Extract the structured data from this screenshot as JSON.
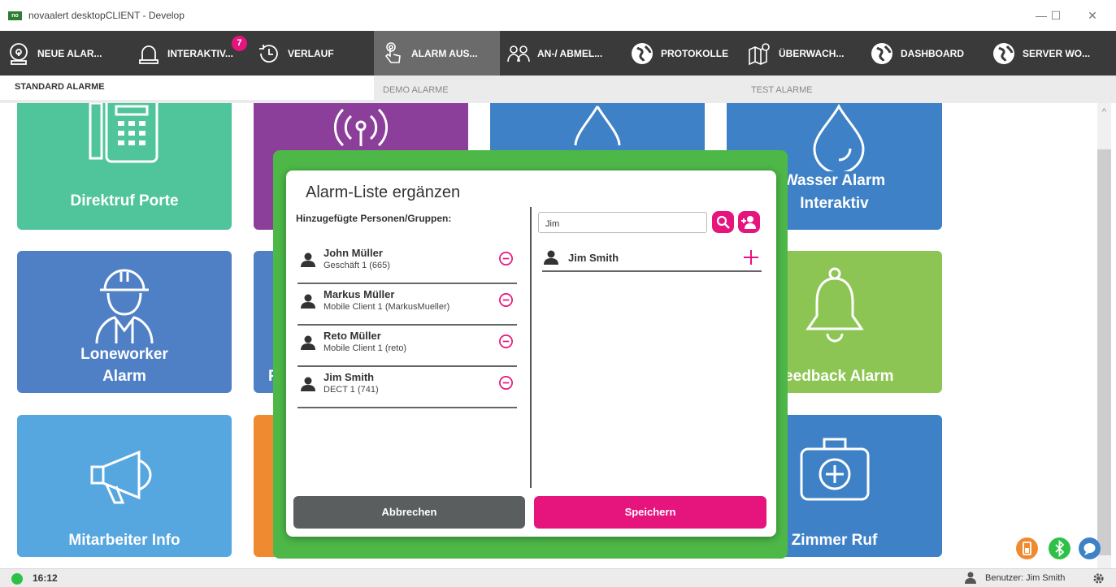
{
  "window": {
    "title": "novaalert desktopCLIENT - Develop",
    "logo_text": "no",
    "min": "—",
    "max": "☐",
    "close": "✕"
  },
  "toolbar": {
    "items": [
      {
        "label": "NEUE ALAR...",
        "icon": "new-alarm-icon"
      },
      {
        "label": "INTERAKTIV...",
        "icon": "siren-icon",
        "badge": "7"
      },
      {
        "label": "VERLAUF",
        "icon": "history-icon"
      },
      {
        "label": "ALARM AUS...",
        "icon": "touch-hand-icon",
        "active": true
      },
      {
        "label": "AN-/ ABMEL...",
        "icon": "users-icon"
      },
      {
        "label": "PROTOKOLLE",
        "icon": "globe-icon"
      },
      {
        "label": "ÜBERWACH...",
        "icon": "map-pin-icon"
      },
      {
        "label": "DASHBOARD",
        "icon": "globe-icon"
      },
      {
        "label": "SERVER WO...",
        "icon": "globe-icon"
      }
    ]
  },
  "tabs": {
    "standard": "STANDARD ALARME",
    "demo": "DEMO ALARME",
    "test": "TEST ALARME"
  },
  "tiles": {
    "direktruf": "Direktruf Porte",
    "wasser_1": "Wasser Alarm",
    "wasser_2": "Interaktiv",
    "loneworker_1": "Loneworker",
    "loneworker_2": "Alarm",
    "feedback": "Feedback Alarm",
    "mitarbeiter": "Mitarbeiter Info",
    "zimmer": "Zimmer Ruf",
    "partial_p": "P"
  },
  "colors": {
    "green_tile": "#50c49b",
    "purple_tile": "#8c3f9a",
    "blue_tile": "#3f81c6",
    "loneworker_tile": "#4f7fc5",
    "light_blue_tile": "#56a6e0",
    "orange_tile": "#f08a30",
    "lime_tile": "#8dc554",
    "accent_pink": "#e5157d",
    "modal_green": "#4db848"
  },
  "dialog": {
    "title": "Alarm-Liste ergänzen",
    "added_heading": "Hinzugefügte Personen/Gruppen:",
    "added": [
      {
        "name": "John Müller",
        "sub": "Geschäft 1 (665)"
      },
      {
        "name": "Markus Müller",
        "sub": "Mobile Client 1 (MarkusMueller)"
      },
      {
        "name": "Reto Müller",
        "sub": "Mobile Client 1 (reto)"
      },
      {
        "name": "Jim Smith",
        "sub": "DECT 1 (741)"
      }
    ],
    "search_value": "Jim",
    "results": [
      {
        "name": "Jim Smith"
      }
    ],
    "cancel": "Abbrechen",
    "save": "Speichern"
  },
  "status": {
    "time": "16:12",
    "user": "Benutzer: Jim Smith"
  }
}
